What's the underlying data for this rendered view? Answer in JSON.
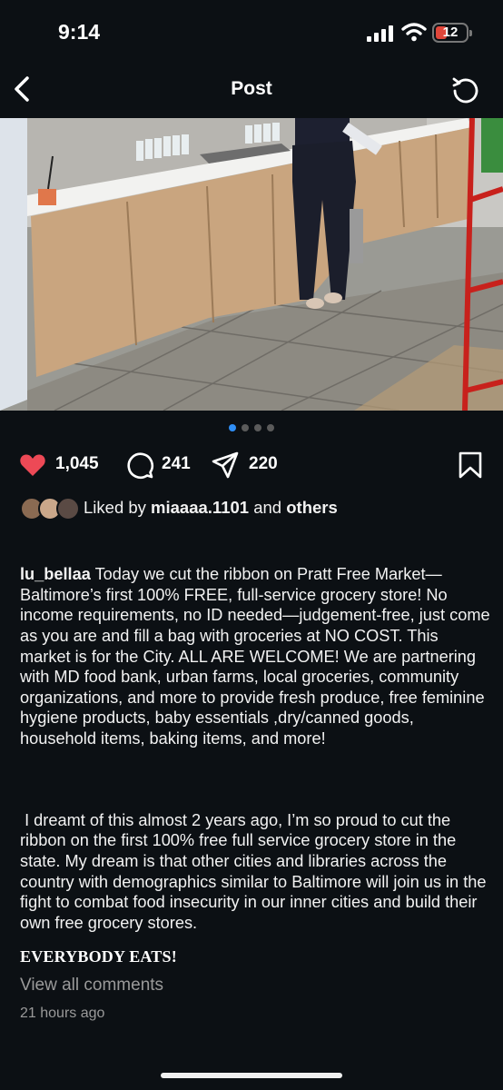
{
  "status_bar": {
    "time": "9:14",
    "battery_level": "12"
  },
  "header": {
    "title": "Post"
  },
  "carousel": {
    "count": 4,
    "active_index": 0
  },
  "actions": {
    "likes": "1,045",
    "comments": "241",
    "shares": "220"
  },
  "likes_line": {
    "prefix": "Liked by ",
    "user": "miaaaa.1101",
    "middle": " and ",
    "suffix": "others"
  },
  "caption": {
    "username": "lu_bellaa",
    "text": " Today we cut the ribbon on Pratt Free Market—Baltimore’s first 100% FREE, full-service grocery store! No income requirements, no ID needed—judgement-free, just come as you are and fill a bag with groceries at NO COST. This market is for the City. ALL ARE WELCOME! We are partnering with MD food bank, urban farms, local groceries, community organizations, and more to provide fresh produce, free feminine hygiene products, baby essentials ,dry/canned goods, household items, baking items, and more!",
    "paragraph2": " I dreamt of this almost 2 years ago, I’m so proud to cut the ribbon on the first 100% free full service grocery store in the state. My dream is that other cities and libraries across the country with demographics similar to Baltimore will join us in the fight to combat food insecurity in our inner cities and build their own free grocery stores.",
    "closing": "EVERYBODY EATS!"
  },
  "comments_link": "View all comments",
  "timestamp": "21 hours ago",
  "colors": {
    "background": "#0c1014",
    "heart": "#ed4956",
    "active_dot": "#2f8ef5",
    "muted_text": "#9a9a9a"
  }
}
